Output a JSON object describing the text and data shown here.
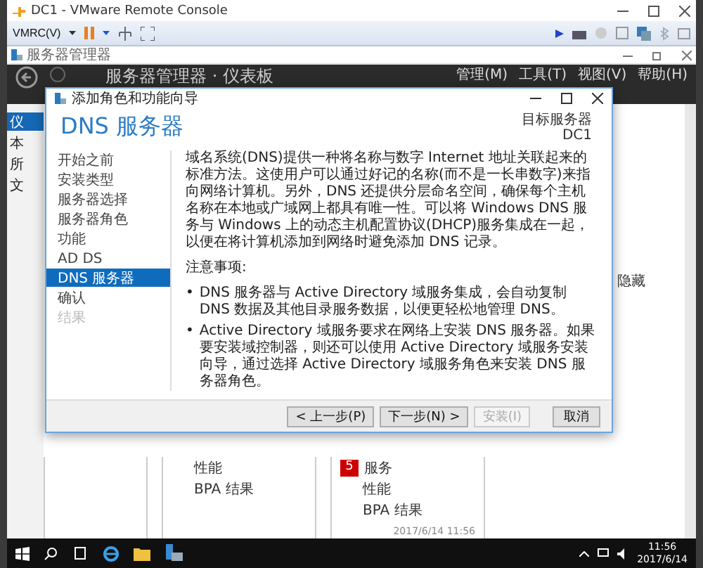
{
  "vmrc": {
    "title": "DC1 - VMware Remote Console",
    "menu": "VMRC(V)"
  },
  "server_manager": {
    "title": "服务器管理器",
    "header": "服务器管理器 · 仪表板",
    "menus": [
      "管理(M)",
      "工具(T)",
      "视图(V)",
      "帮助(H)"
    ],
    "nav": [
      {
        "label": "仪",
        "selected": true
      },
      {
        "label": "本",
        "selected": false
      },
      {
        "label": "所",
        "selected": false
      },
      {
        "label": "文",
        "selected": false
      }
    ],
    "hide_link": "隐藏",
    "tiles": [
      {
        "items": [
          "性能",
          "BPA 结果"
        ]
      },
      {
        "badge": "5",
        "title": "服务",
        "items": [
          "性能",
          "BPA 结果"
        ],
        "timestamp": "2017/6/14 11:56"
      }
    ]
  },
  "wizard": {
    "title": "添加角色和功能向导",
    "heading": "DNS 服务器",
    "target_label": "目标服务器",
    "target": "DC1",
    "steps": [
      {
        "label": "开始之前",
        "selected": false,
        "disabled": false
      },
      {
        "label": "安装类型",
        "selected": false,
        "disabled": false
      },
      {
        "label": "服务器选择",
        "selected": false,
        "disabled": false
      },
      {
        "label": "服务器角色",
        "selected": false,
        "disabled": false
      },
      {
        "label": "功能",
        "selected": false,
        "disabled": false
      },
      {
        "label": "AD DS",
        "selected": false,
        "disabled": false
      },
      {
        "label": "DNS 服务器",
        "selected": true,
        "disabled": false
      },
      {
        "label": "确认",
        "selected": false,
        "disabled": false
      },
      {
        "label": "结果",
        "selected": false,
        "disabled": true
      }
    ],
    "description": "域名系统(DNS)提供一种将名称与数字 Internet 地址关联起来的标准方法。这使用户可以通过好记的名称(而不是一长串数字)来指向网络计算机。另外，DNS 还提供分层命名空间，确保每个主机名称在本地或广域网上都具有唯一性。可以将 Windows DNS 服务与 Windows 上的动态主机配置协议(DHCP)服务集成在一起，以便在将计算机添加到网络时避免添加 DNS 记录。",
    "notes_title": "注意事项:",
    "notes": [
      {
        "bullet": "•",
        "text": "DNS 服务器与 Active Directory 域服务集成，会自动复制 DNS 数据及其他目录服务数据，以便更轻松地管理 DNS。"
      },
      {
        "bullet": "•",
        "text": "Active Directory 域服务要求在网络上安装 DNS 服务器。如果要安装域控制器，则还可以使用 Active Directory 域服务安装向导，通过选择 Active Directory 域服务角色来安装 DNS 服务器角色。"
      }
    ],
    "buttons": [
      {
        "label": "< 上一步(P)",
        "disabled": false
      },
      {
        "label": "下一步(N) >",
        "disabled": false
      },
      {
        "label": "安装(I)",
        "disabled": true
      },
      {
        "label": "取消",
        "disabled": false
      }
    ]
  },
  "taskbar": {
    "time": "11:56",
    "date": "2017/6/14"
  }
}
